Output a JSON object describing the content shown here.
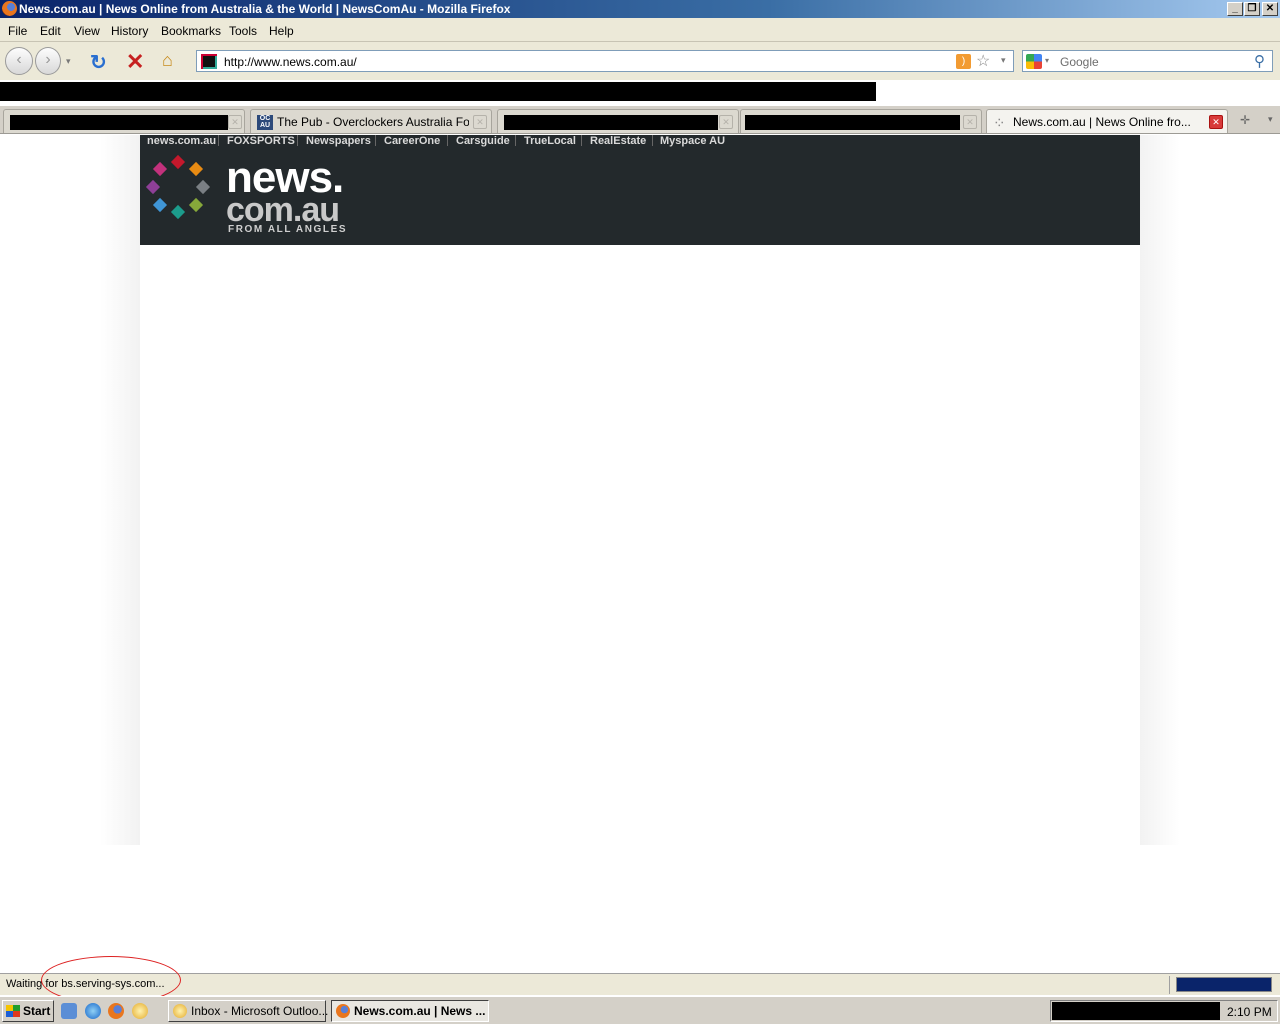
{
  "window": {
    "title": "News.com.au | News Online from Australia & the World | NewsComAu - Mozilla Firefox"
  },
  "menu": [
    "File",
    "Edit",
    "View",
    "History",
    "Bookmarks",
    "Tools",
    "Help"
  ],
  "navbar": {
    "url": "http://www.news.com.au/",
    "search_placeholder": "Google"
  },
  "tabs": [
    {
      "label": "",
      "redacted": true,
      "active": false
    },
    {
      "label": "The Pub - Overclockers Australia Foru...",
      "redacted": false,
      "active": false
    },
    {
      "label": "",
      "redacted": true,
      "active": false
    },
    {
      "label": "",
      "redacted": true,
      "active": false
    },
    {
      "label": "News.com.au | News Online fro...",
      "redacted": false,
      "active": true
    }
  ],
  "site": {
    "nav": [
      "news.com.au",
      "FOXSPORTS",
      "Newspapers",
      "CareerOne",
      "Carsguide",
      "TrueLocal",
      "RealEstate",
      "Myspace AU"
    ],
    "logo_top": "news.",
    "logo_bottom": "com.au",
    "tagline": "FROM ALL ANGLES",
    "dot_colors": [
      "#c4182c",
      "#e88b13",
      "#7a7f84",
      "#86a83a",
      "#1c9c8c",
      "#3f95d6",
      "#8e3f97",
      "#c2317c"
    ]
  },
  "status": {
    "text": "Waiting for bs.serving-sys.com..."
  },
  "taskbar": {
    "start": "Start",
    "tasks": [
      {
        "label": "Inbox - Microsoft Outloo...",
        "active": false
      },
      {
        "label": "News.com.au | News ...",
        "active": true
      }
    ],
    "clock": "2:10 PM"
  }
}
